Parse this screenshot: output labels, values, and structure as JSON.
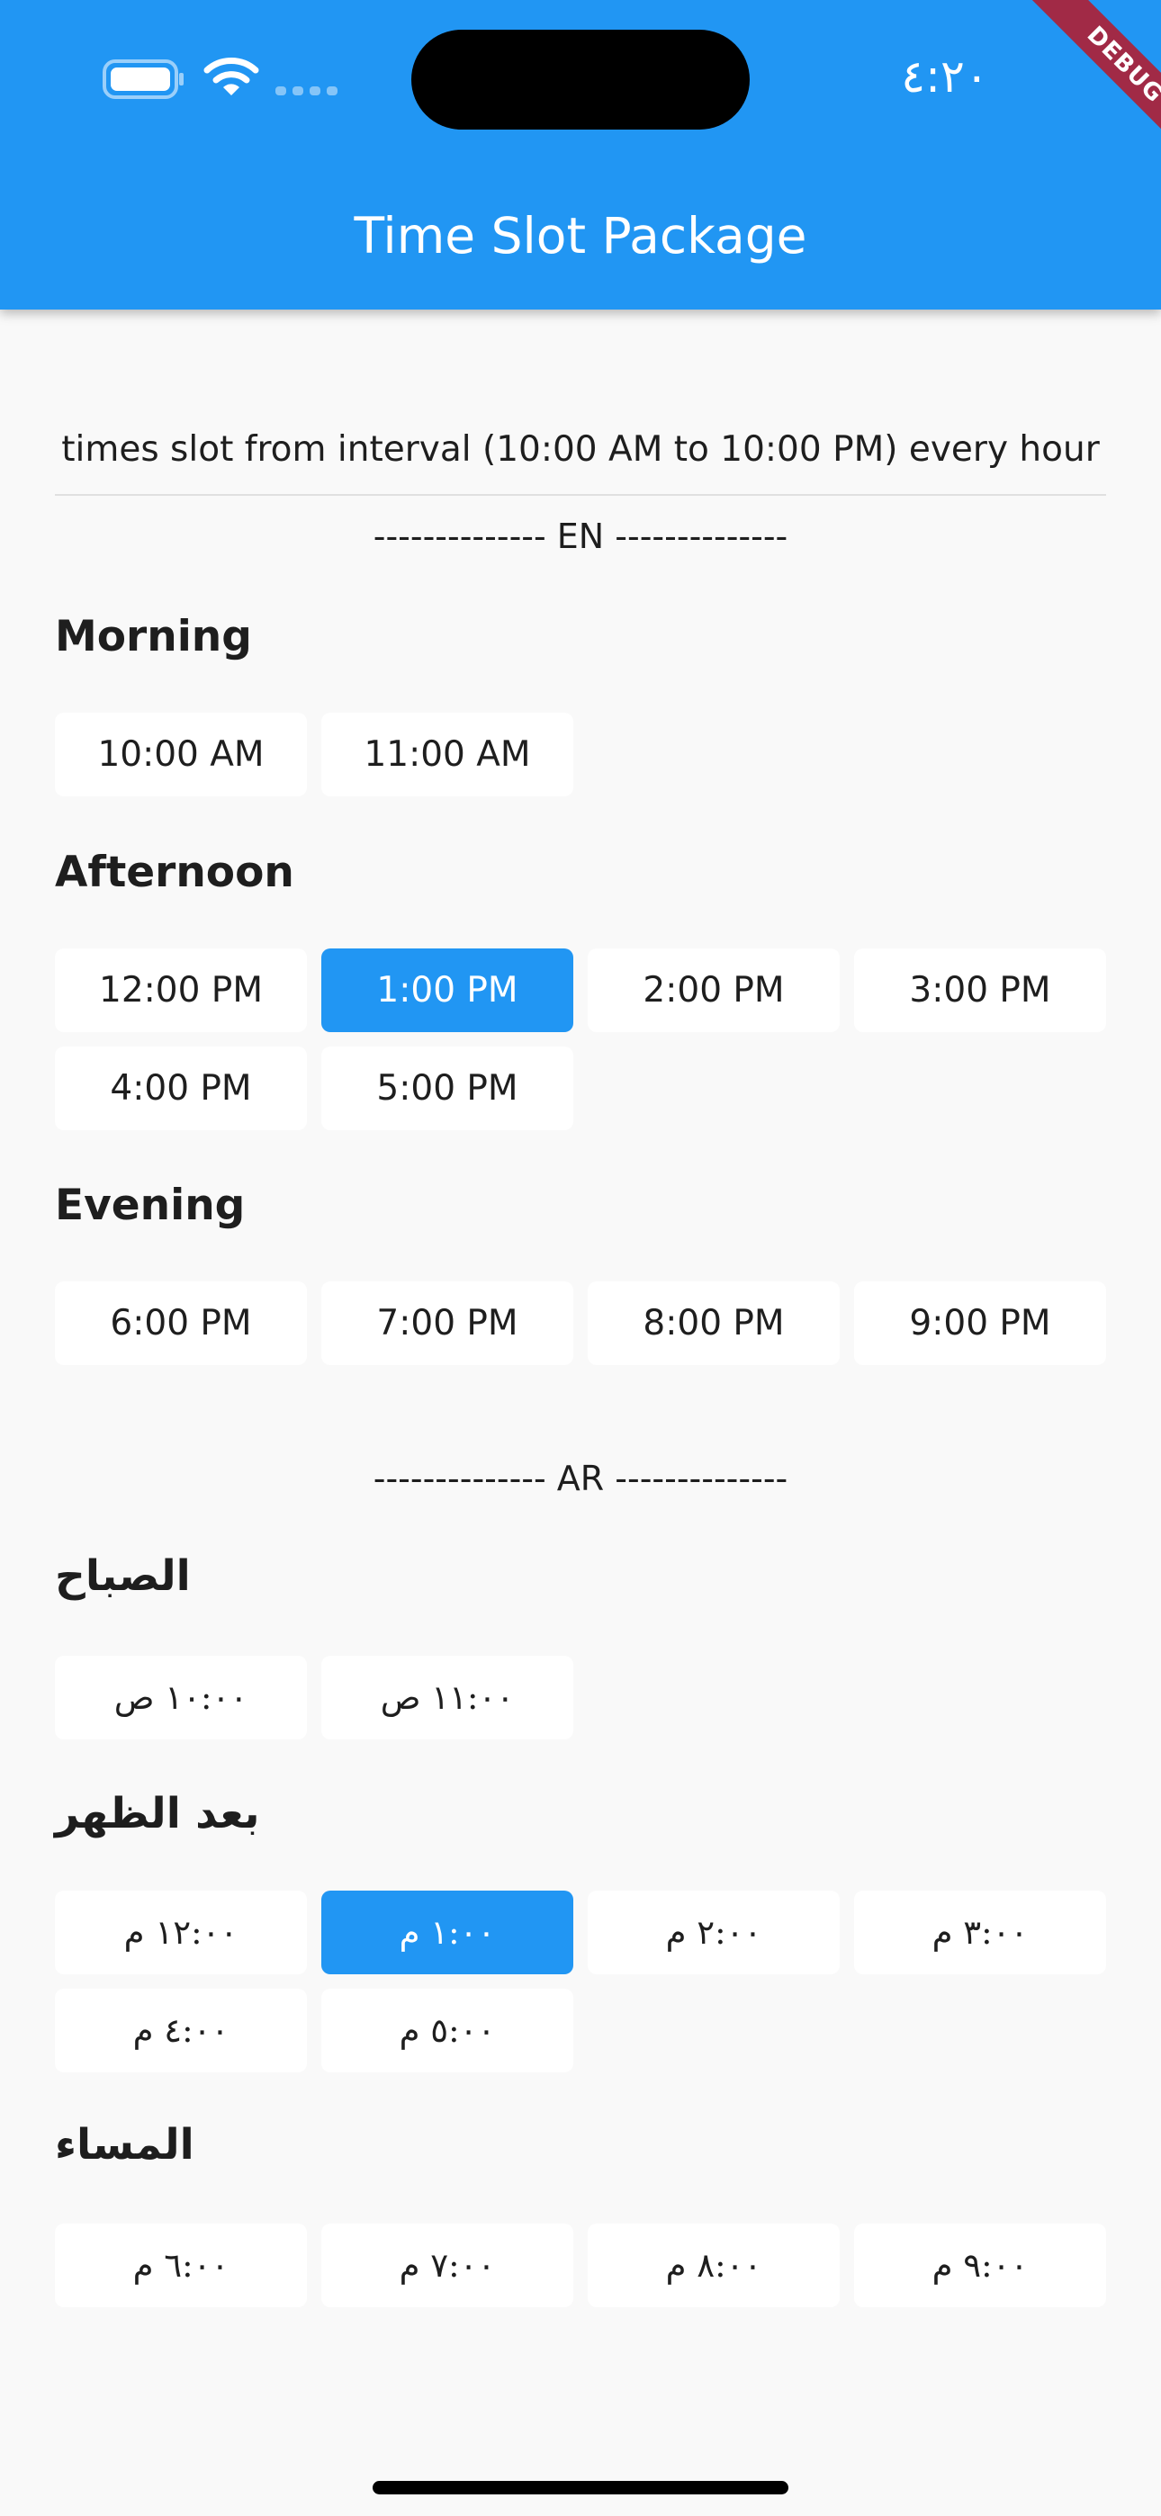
{
  "status_bar": {
    "time": "٤:٢٠",
    "battery_icon": "battery-icon",
    "wifi_icon": "wifi-icon",
    "signal_icon": "signal-icon"
  },
  "debug_banner": "DEBUG",
  "app_bar": {
    "title": "Time Slot Package"
  },
  "interval_text": "times slot from interval (10:00 AM to 10:00 PM) every hour",
  "colors": {
    "accent": "#2196f3",
    "background": "#f9f9f9",
    "slot_background": "#ffffff",
    "banner": "#a12a46"
  },
  "en": {
    "separator": "-------------- EN --------------",
    "morning": {
      "title": "Morning",
      "slots": [
        "10:00 AM",
        "11:00 AM"
      ]
    },
    "afternoon": {
      "title": "Afternoon",
      "slots": [
        "12:00 PM",
        "1:00 PM",
        "2:00 PM",
        "3:00 PM",
        "4:00 PM",
        "5:00 PM"
      ],
      "selected": "1:00 PM"
    },
    "evening": {
      "title": "Evening",
      "slots": [
        "6:00 PM",
        "7:00 PM",
        "8:00 PM",
        "9:00 PM"
      ]
    }
  },
  "ar": {
    "separator": "-------------- AR --------------",
    "morning": {
      "title": "الصباح",
      "slots": [
        "١٠:٠٠ ص",
        "١١:٠٠ ص"
      ]
    },
    "afternoon": {
      "title": "بعد الظهر",
      "slots": [
        "١٢:٠٠ م",
        "١:٠٠ م",
        "٢:٠٠ م",
        "٣:٠٠ م",
        "٤:٠٠ م",
        "٥:٠٠ م"
      ],
      "selected": "١:٠٠ م"
    },
    "evening": {
      "title": "المساء",
      "slots": [
        "٦:٠٠ م",
        "٧:٠٠ م",
        "٨:٠٠ م",
        "٩:٠٠ م"
      ]
    }
  }
}
